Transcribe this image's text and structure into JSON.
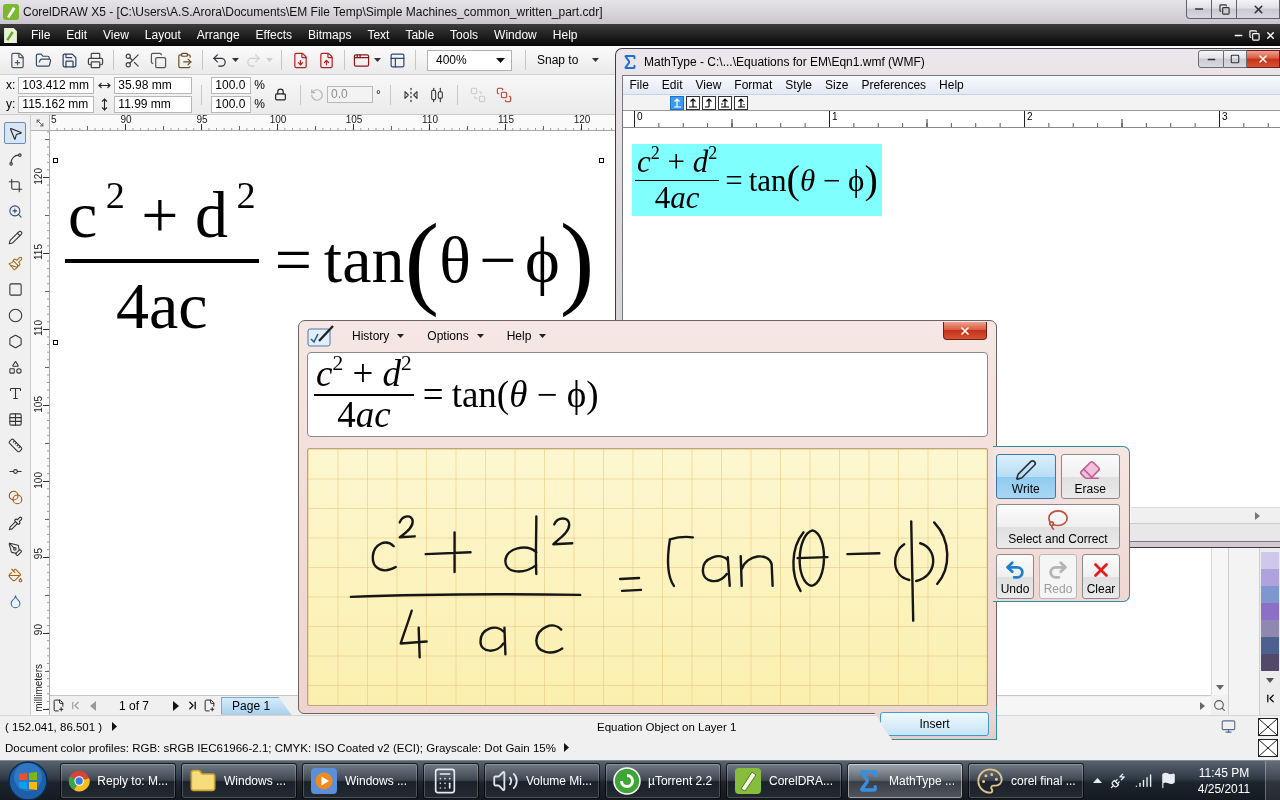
{
  "coreldraw": {
    "title": "CorelDRAW X5 - [C:\\Users\\A.S.Arora\\Documents\\EM File Temp\\Simple Machines_common_written_part.cdr]",
    "menu": [
      "File",
      "Edit",
      "View",
      "Layout",
      "Arrange",
      "Effects",
      "Bitmaps",
      "Text",
      "Table",
      "Tools",
      "Window",
      "Help"
    ],
    "toolbar": [
      {
        "kind": "new",
        "disabled": false
      },
      {
        "kind": "open",
        "disabled": false
      },
      {
        "kind": "save",
        "disabled": false
      },
      {
        "kind": "print",
        "disabled": false
      },
      {
        "kind": "cut",
        "disabled": false
      },
      {
        "kind": "copy",
        "disabled": false
      },
      {
        "kind": "paste",
        "disabled": false
      },
      {
        "kind": "undo",
        "disabled": false
      },
      {
        "kind": "redo",
        "disabled": true
      },
      {
        "kind": "import",
        "disabled": false
      },
      {
        "kind": "export",
        "disabled": false
      },
      {
        "kind": "launcher",
        "disabled": false
      },
      {
        "kind": "welcome",
        "disabled": false
      }
    ],
    "zoom": "400%",
    "snap": "Snap to",
    "position": {
      "x_label": "x:",
      "x": "103.412 mm",
      "y_label": "y:",
      "y": "115.162 mm"
    },
    "size": {
      "width": "35.98 mm",
      "height": "11.99 mm"
    },
    "scale": [
      {
        "value": "100.0",
        "unit": "%"
      },
      {
        "value": "100.0",
        "unit": "%"
      }
    ],
    "rotation": {
      "value": "0.0",
      "unit": "°",
      "disabled": true
    },
    "arrange": [
      {
        "kind": "mirror",
        "disabled": false
      },
      {
        "kind": "align",
        "disabled": false
      },
      {
        "kind": "back",
        "disabled": true
      },
      {
        "kind": "front",
        "disabled": false
      }
    ],
    "toolbox": [
      {
        "kind": "pick",
        "selected": true
      },
      {
        "kind": "shape",
        "selected": false
      },
      {
        "kind": "crop",
        "selected": false
      },
      {
        "kind": "zoom",
        "selected": false
      },
      {
        "kind": "freehand",
        "selected": false
      },
      {
        "kind": "smart_fill",
        "selected": false
      },
      {
        "kind": "rectangle",
        "selected": false
      },
      {
        "kind": "ellipse",
        "selected": false
      },
      {
        "kind": "polygon",
        "selected": false
      },
      {
        "kind": "basic_shapes",
        "selected": false
      },
      {
        "kind": "text",
        "selected": false
      },
      {
        "kind": "table",
        "selected": false
      },
      {
        "kind": "dimension",
        "selected": false
      },
      {
        "kind": "connector",
        "selected": false
      },
      {
        "kind": "blend",
        "selected": false
      },
      {
        "kind": "eyedropper",
        "selected": false
      },
      {
        "kind": "outline",
        "selected": false
      },
      {
        "kind": "fill",
        "selected": false
      },
      {
        "kind": "interactive_fill",
        "selected": false
      }
    ],
    "h_ruler": [
      "5",
      "90",
      "95",
      "100",
      "105",
      "110",
      "115",
      "120"
    ],
    "v_ruler": [
      "120",
      "115",
      "110",
      "105",
      "100",
      "95",
      "90"
    ],
    "ruler_unit": "millimeters",
    "equation": {
      "numerator": "c$^{2}$ + d$^{2}$",
      "denominator": "4ac",
      "equals": "=",
      "function": "tan",
      "open": "(",
      "argument": "θ − ϕ",
      "close": ")"
    },
    "page_nav": {
      "count": "1 of 7",
      "tab": "Page 1"
    },
    "palette": [
      {
        "color": "#cfc8ea"
      },
      {
        "color": "#afa2df"
      },
      {
        "color": "#7e97d0"
      },
      {
        "color": "#8c70c6"
      },
      {
        "color": "#9088b0"
      },
      {
        "color": "#4e6090"
      },
      {
        "color": "#524a68"
      }
    ],
    "status": {
      "coordinates": "( 152.041, 86.501 )",
      "object": "Equation Object on Layer 1",
      "profiles": "Document color profiles: RGB: sRGB IEC61966-2.1; CMYK: ISO Coated v2 (ECI); Grayscale: Dot Gain 15%"
    }
  },
  "mathtype": {
    "title": "MathType - C:\\...\\Equations for EM\\Eqn1.wmf (WMF)",
    "menu": [
      "File",
      "Edit",
      "View",
      "Format",
      "Style",
      "Size",
      "Preferences",
      "Help"
    ],
    "tab_stops": [
      {
        "kind": "left",
        "selected": true
      },
      {
        "kind": "center",
        "selected": false
      },
      {
        "kind": "right",
        "selected": false
      },
      {
        "kind": "relation",
        "selected": false
      },
      {
        "kind": "decimal",
        "selected": false
      }
    ],
    "ruler": [
      "0",
      "1",
      "2",
      "3"
    ],
    "equation": {
      "numerator": "*c*$^{2}$ + *d*$^{2}$",
      "denominator": {
        "number": "4",
        "letters": "ac"
      },
      "equals": "=",
      "function": "tan",
      "open": "(",
      "argument": "*θ* − ϕ",
      "close": ")",
      "selected": true
    }
  },
  "math_input_panel": {
    "menu": [
      "History",
      "Options",
      "Help"
    ],
    "preview": {
      "numerator": "*c*$^{2}$ + *d*$^{2}$",
      "denominator": {
        "number": "4",
        "letters": "ac"
      },
      "equals": "=",
      "function": "tan",
      "open": "(",
      "argument": "*θ* − ϕ",
      "close": ")"
    },
    "tools": [
      {
        "kind": "write",
        "label": "Write",
        "selected": true,
        "disabled": false
      },
      {
        "kind": "erase",
        "label": "Erase",
        "selected": false,
        "disabled": false
      },
      {
        "kind": "select",
        "label": "Select and Correct",
        "selected": false,
        "disabled": false
      },
      {
        "kind": "undo",
        "label": "Undo",
        "selected": false,
        "disabled": false
      },
      {
        "kind": "redo",
        "label": "Redo",
        "selected": false,
        "disabled": true
      },
      {
        "kind": "clear",
        "label": "Clear",
        "selected": false,
        "disabled": false
      }
    ],
    "insert": "Insert"
  },
  "taskbar": {
    "items": [
      {
        "kind": "browser",
        "label": "Reply to: M...",
        "active": false
      },
      {
        "kind": "folder",
        "label": "Windows ...",
        "active": false
      },
      {
        "kind": "media",
        "label": "Windows ...",
        "active": false
      },
      {
        "kind": "calculator",
        "active": false
      },
      {
        "kind": "volume",
        "label": "Volume Mi...",
        "active": false
      },
      {
        "kind": "torrent",
        "label": "µTorrent 2.2",
        "active": false
      },
      {
        "kind": "corel",
        "label": "CorelDRA...",
        "active": false
      },
      {
        "kind": "mathtype",
        "label": "MathType ...",
        "active": true
      },
      {
        "kind": "paint",
        "label": "corel final ...",
        "active": false
      }
    ],
    "time": "11:45 PM",
    "date": "4/25/2011"
  }
}
